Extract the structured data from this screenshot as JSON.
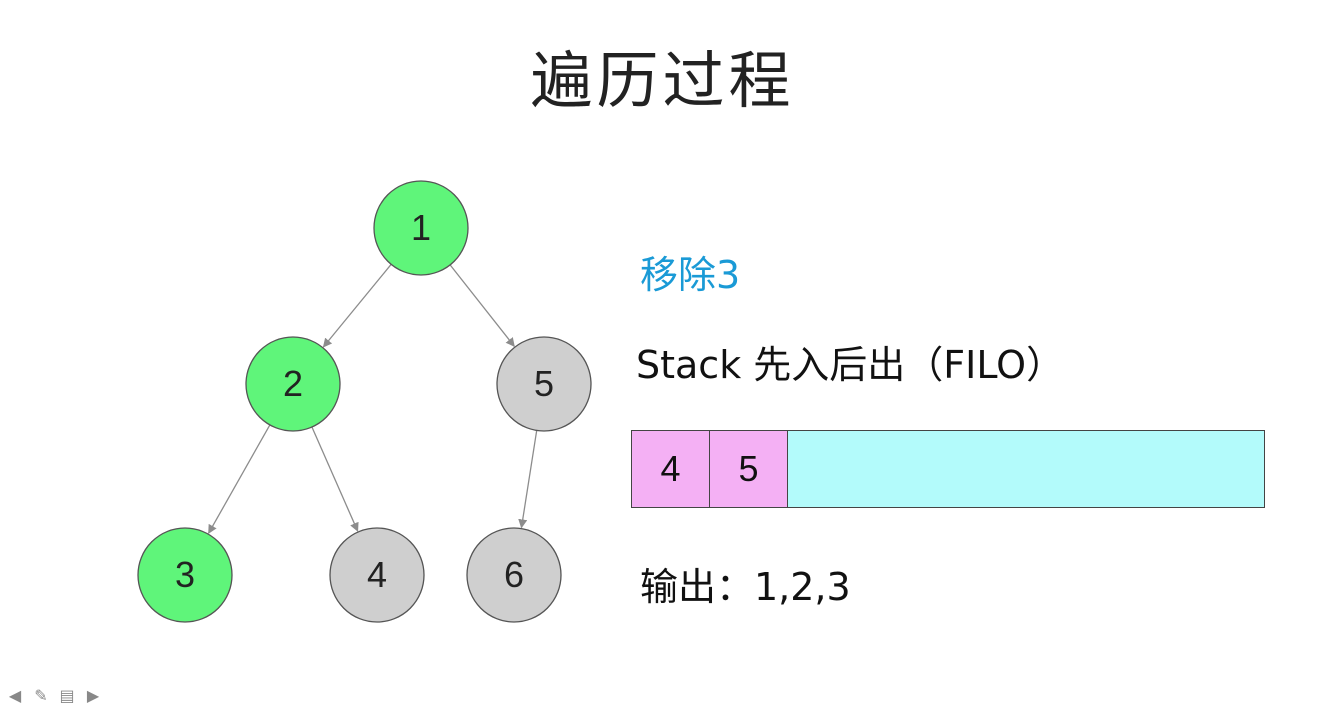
{
  "title": "遍历过程",
  "tree": {
    "nodes": [
      {
        "id": "1",
        "label": "1",
        "state": "visited"
      },
      {
        "id": "2",
        "label": "2",
        "state": "visited"
      },
      {
        "id": "5",
        "label": "5",
        "state": "pending"
      },
      {
        "id": "3",
        "label": "3",
        "state": "visited"
      },
      {
        "id": "4",
        "label": "4",
        "state": "pending"
      },
      {
        "id": "6",
        "label": "6",
        "state": "pending"
      }
    ],
    "edges": [
      [
        "1",
        "2"
      ],
      [
        "1",
        "5"
      ],
      [
        "2",
        "3"
      ],
      [
        "2",
        "4"
      ],
      [
        "5",
        "6"
      ]
    ],
    "colors": {
      "visited": "#5ff57a",
      "pending": "#cfcfcf"
    }
  },
  "step_label": "移除3",
  "stack": {
    "caption": "Stack 先入后出（FILO）",
    "items": [
      "4",
      "5"
    ],
    "colors": {
      "item": "#f4b0f4",
      "empty": "#b3fbfb"
    }
  },
  "output": "输出：1,2,3",
  "toolbar_icons": [
    "arrow-left-icon",
    "pencil-icon",
    "slides-icon",
    "arrow-right-icon"
  ]
}
